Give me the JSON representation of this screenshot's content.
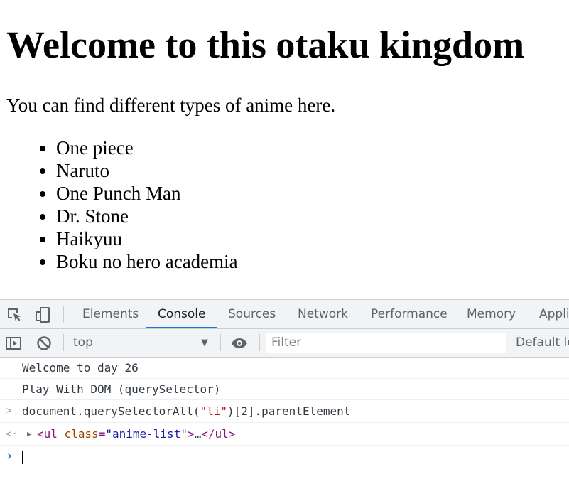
{
  "page": {
    "heading": "Welcome to this otaku kingdom",
    "intro": "You can find different types of anime here.",
    "anime_list": [
      "One piece",
      "Naruto",
      "One Punch Man",
      "Dr. Stone",
      "Haikyuu",
      "Boku no hero academia"
    ]
  },
  "devtools": {
    "tabs": [
      "Elements",
      "Console",
      "Sources",
      "Network",
      "Performance",
      "Memory",
      "Appli"
    ],
    "active_tab": "Console",
    "context": "top",
    "context_caret": "▼",
    "filter_placeholder": "Filter",
    "levels_label": "Default le",
    "console": {
      "logs": [
        "Welcome to day 26",
        "Play With DOM (querySelector)"
      ],
      "input_marker": ">",
      "command_parts": [
        "document.querySelectorAll(",
        "\"li\"",
        ")[2].parentElement"
      ],
      "result_marker": "<·",
      "result": {
        "open_tag": "<ul",
        "attr_name": "class",
        "equals": "=",
        "attr_value": "\"anime-list\"",
        "close_open": ">",
        "ellipsis": "…",
        "close_tag": "</ul>"
      },
      "prompt_marker": "›"
    },
    "colors": {
      "accent": "#1a73e8",
      "string": "#c41a16",
      "tag": "#881280",
      "attr": "#994500",
      "value": "#1a1aa6"
    },
    "icons": [
      "inspect-element-icon",
      "device-toolbar-icon",
      "sidebar-toggle-icon",
      "clear-console-icon",
      "eye-icon"
    ]
  }
}
